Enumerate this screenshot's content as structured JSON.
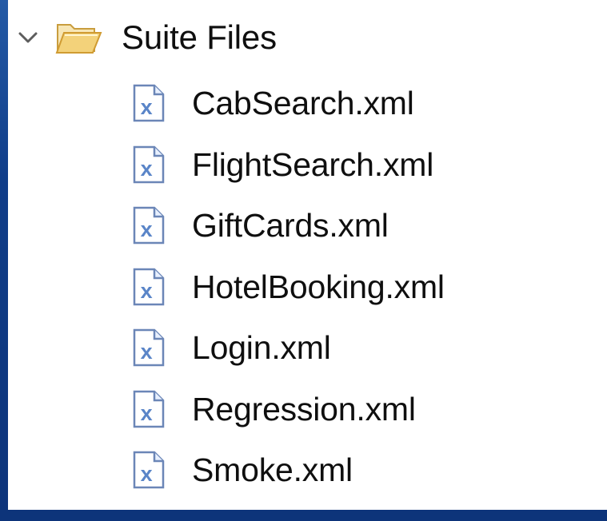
{
  "tree": {
    "folder": {
      "label": "Suite Files",
      "expanded": true,
      "icon": "folder-open-icon"
    },
    "files": [
      {
        "label": "CabSearch.xml",
        "icon": "xml-file-icon"
      },
      {
        "label": "FlightSearch.xml",
        "icon": "xml-file-icon"
      },
      {
        "label": "GiftCards.xml",
        "icon": "xml-file-icon"
      },
      {
        "label": "HotelBooking.xml",
        "icon": "xml-file-icon"
      },
      {
        "label": "Login.xml",
        "icon": "xml-file-icon"
      },
      {
        "label": "Regression.xml",
        "icon": "xml-file-icon"
      },
      {
        "label": "Smoke.xml",
        "icon": "xml-file-icon"
      }
    ]
  },
  "colors": {
    "frame": "#0f3f86",
    "panel": "#ffffff",
    "text": "#0f0f0f",
    "folder": "#f3d27a",
    "xml_icon_blue": "#5a85c8"
  }
}
